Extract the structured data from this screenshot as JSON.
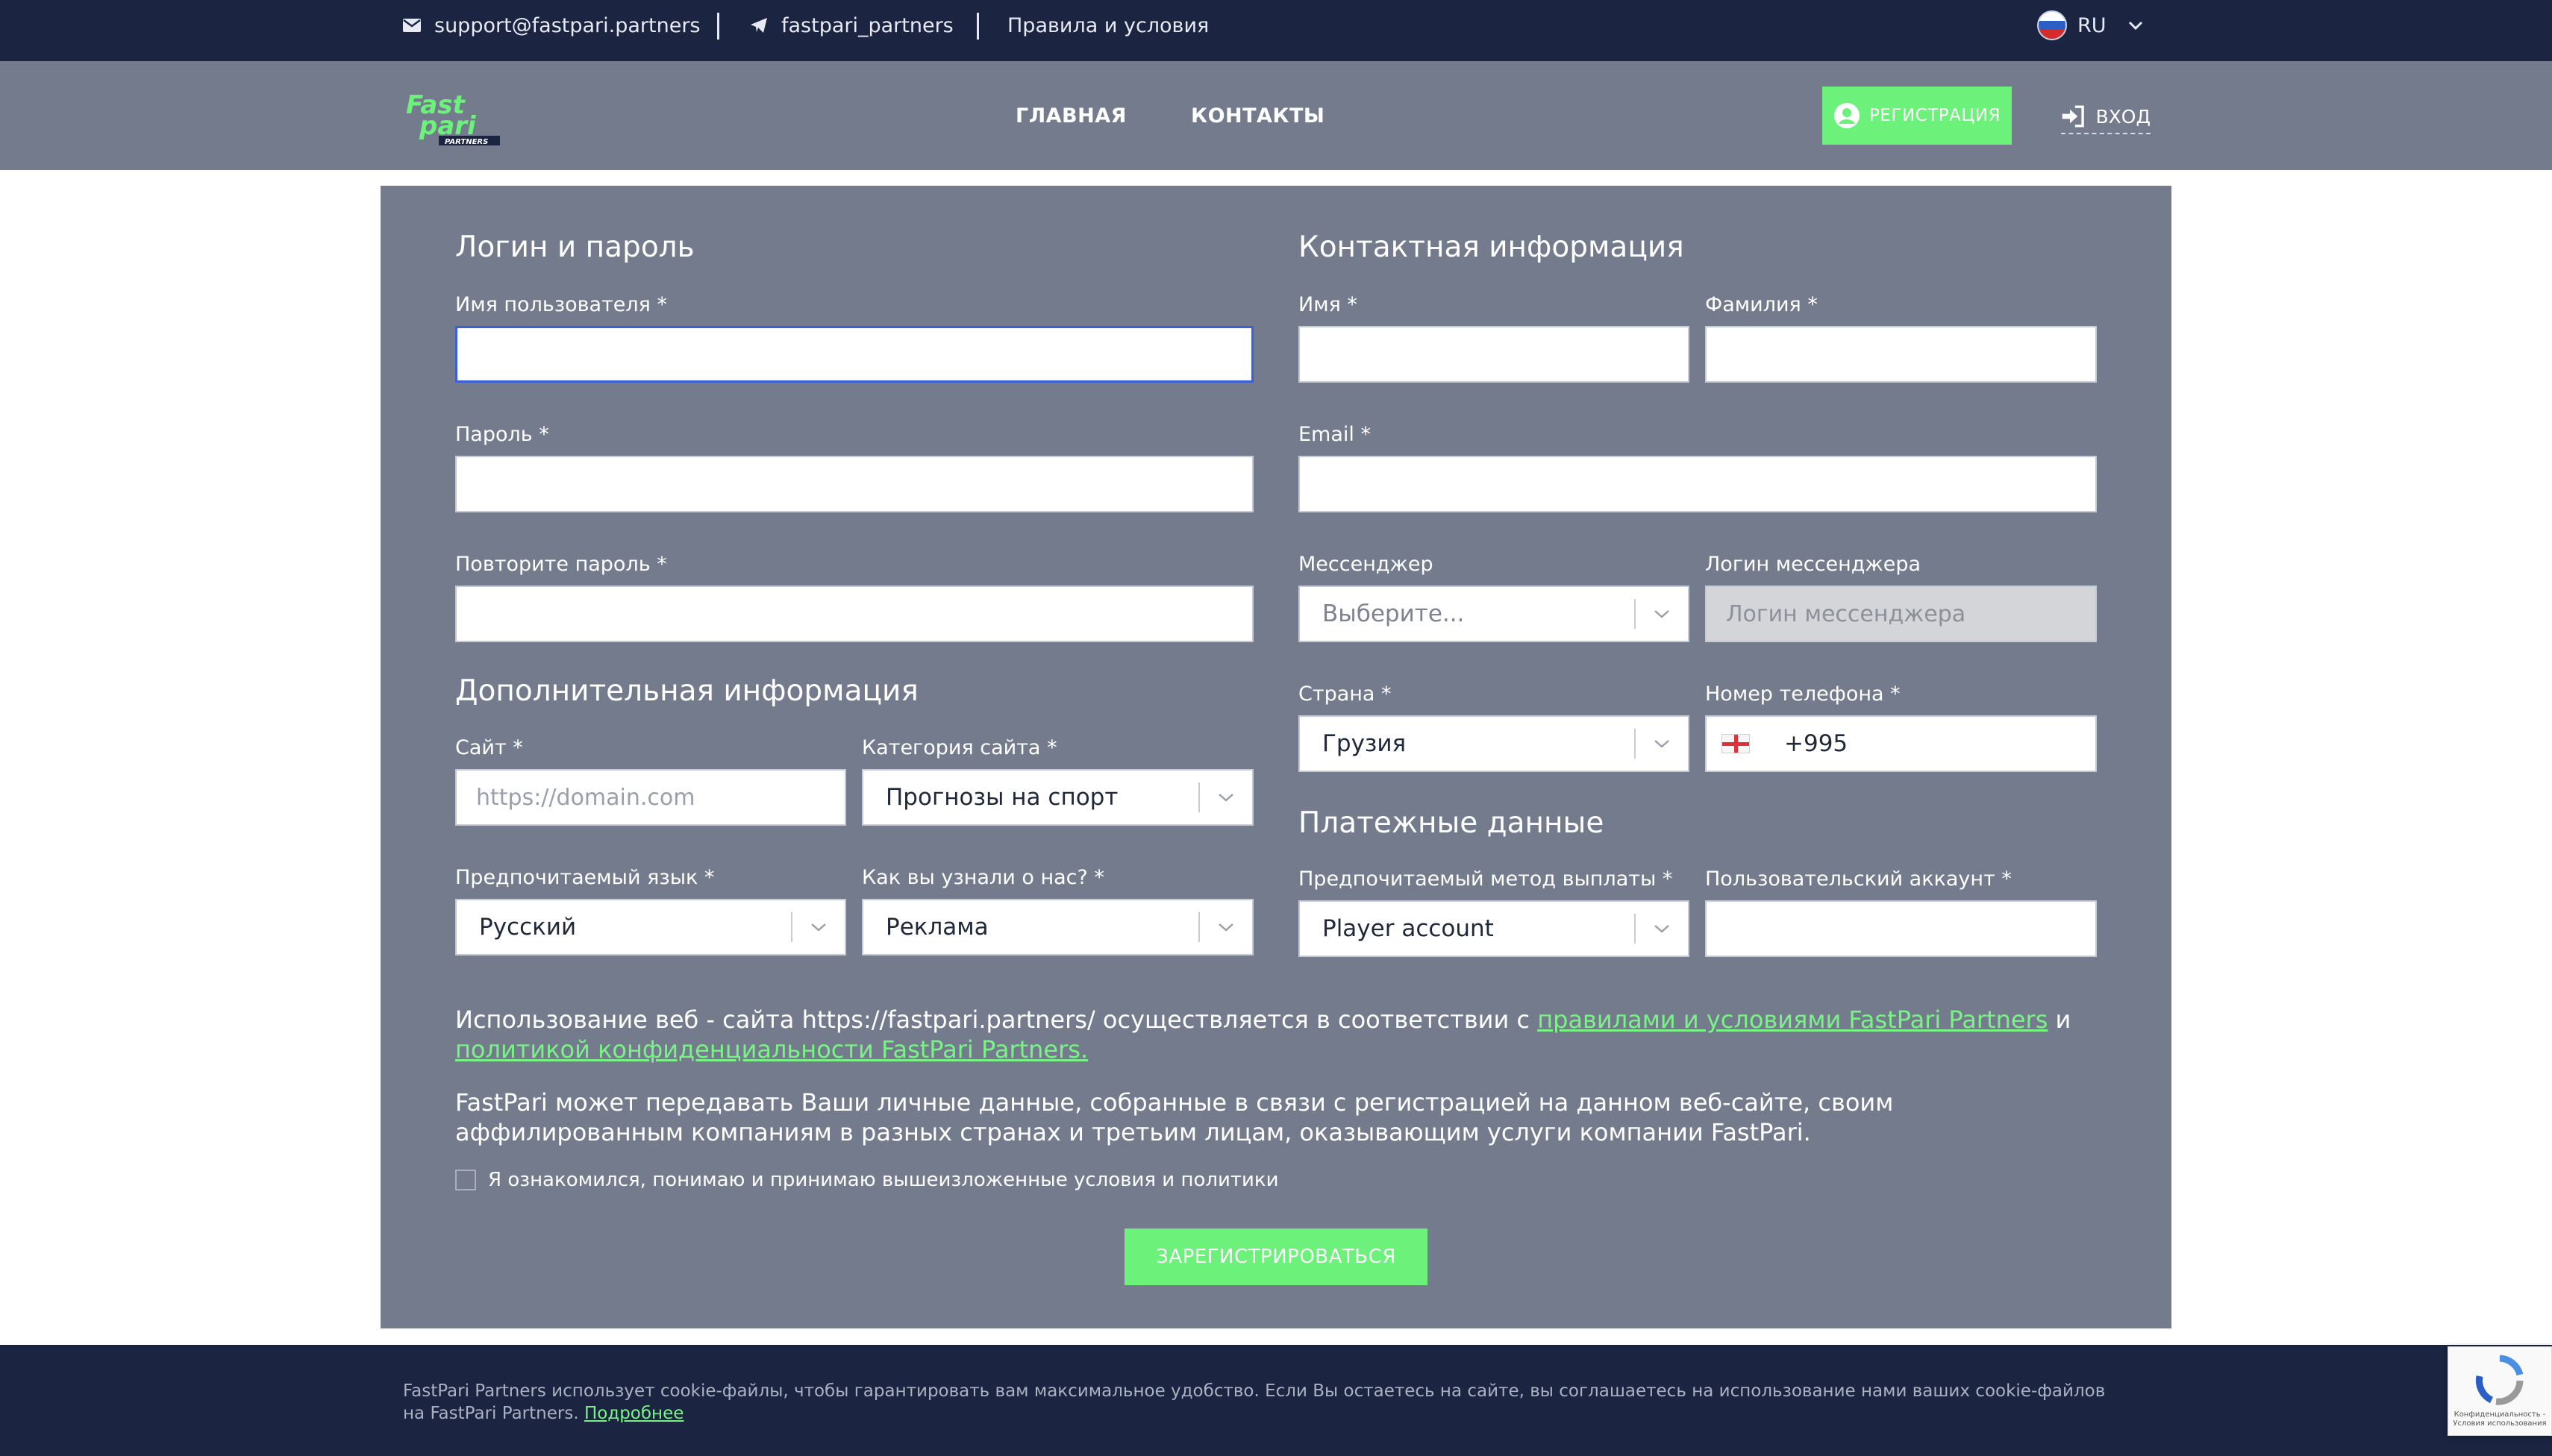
{
  "topbar": {
    "email": "support@fastpari.partners",
    "telegram": "fastpari_partners",
    "terms": "Правила и условия",
    "lang": "RU"
  },
  "nav": {
    "logo_line1": "Fast",
    "logo_line2": "pari",
    "logo_sub": "PARTNERS",
    "home": "ГЛАВНАЯ",
    "contacts": "КОНТАКТЫ",
    "register": "РЕГИСТРАЦИЯ",
    "login": "ВХОД"
  },
  "form": {
    "login_section": "Логин и пароль",
    "username_label": "Имя пользователя *",
    "password_label": "Пароль *",
    "password_repeat_label": "Повторите пароль *",
    "extra_section": "Дополнительная информация",
    "site_label": "Сайт *",
    "site_placeholder": "https://domain.com",
    "site_category_label": "Категория сайта *",
    "site_category_value": "Прогнозы на спорт",
    "language_label": "Предпочитаемый язык *",
    "language_value": "Русский",
    "source_label": "Как вы узнали о нас? *",
    "source_value": "Реклама",
    "contact_section": "Контактная информация",
    "first_name_label": "Имя *",
    "last_name_label": "Фамилия *",
    "email_label": "Email *",
    "messenger_label": "Мессенджер",
    "messenger_placeholder": "Выберите...",
    "messenger_login_label": "Логин мессенджера",
    "messenger_login_placeholder": "Логин мессенджера",
    "country_label": "Страна *",
    "country_value": "Грузия",
    "phone_label": "Номер телефона *",
    "phone_value": "+995",
    "payment_section": "Платежные данные",
    "payout_label": "Предпочитаемый метод выплаты *",
    "payout_value": "Player account",
    "account_label": "Пользовательский аккаунт *",
    "terms_text_1": "Использование веб - сайта https://fastpari.partners/ осуществляется в соответствии с ",
    "terms_link_1": "правилами и условиями FastPari Partners",
    "terms_and": " и ",
    "terms_link_2": "политикой конфиденциальности FastPari Partners.",
    "data_text": "FastPari может передавать Ваши личные данные, собранные в связи с регистрацией на данном веб-сайте, своим аффилированным компаниям в разных странах и третьим лицам, оказывающим услуги компании FastPari.",
    "checkbox_label": "Я ознакомился, понимаю и принимаю вышеизложенные условия и политики",
    "submit": "ЗАРЕГИСТРИРОВАТЬСЯ"
  },
  "footer": {
    "cookie_text": "FastPari Partners использует cookie-файлы, чтобы гарантировать вам максимальное удобство. Если Вы остаетесь на сайте, вы соглашаетесь на использование нами ваших cookie-файлов на FastPari Partners. ",
    "more_link": "Подробнее",
    "recaptcha_text": "Конфиденциальность - Условия использования"
  },
  "colors": {
    "accent_green": "#6cf27a",
    "dark_navy": "#1b2440",
    "panel_gray": "#737b8c"
  },
  "icons": [
    "mail-icon",
    "telegram-icon",
    "flag-ru-icon",
    "chevron-down-icon",
    "user-circle-icon",
    "login-icon",
    "flag-ge-icon",
    "recaptcha-icon"
  ]
}
